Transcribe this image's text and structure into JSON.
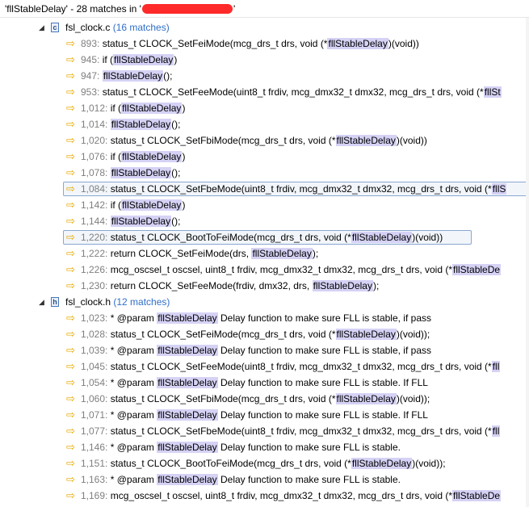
{
  "header": {
    "text_before": "'fllStableDelay' - 28 matches in '",
    "text_after": "'"
  },
  "files": [
    {
      "name": "fsl_clock.c",
      "count": "(16 matches)",
      "matches": [
        {
          "line": "893:",
          "before": "status_t CLOCK_SetFeiMode(mcg_drs_t drs, void (*",
          "hl": "fllStableDelay",
          "after": ")(void))"
        },
        {
          "line": "945:",
          "before": "if (",
          "hl": "fllStableDelay",
          "after": ")"
        },
        {
          "line": "947:",
          "before": "",
          "hl": "fllStableDelay",
          "after": "();"
        },
        {
          "line": "953:",
          "before": "status_t CLOCK_SetFeeMode(uint8_t frdiv, mcg_dmx32_t dmx32, mcg_drs_t drs, void (*",
          "hl": "fllSt",
          "after": ""
        },
        {
          "line": "1,012:",
          "before": "if (",
          "hl": "fllStableDelay",
          "after": ")"
        },
        {
          "line": "1,014:",
          "before": "",
          "hl": "fllStableDelay",
          "after": "();"
        },
        {
          "line": "1,020:",
          "before": "status_t CLOCK_SetFbiMode(mcg_drs_t drs, void (*",
          "hl": "fllStableDelay",
          "after": ")(void))"
        },
        {
          "line": "1,076:",
          "before": "if (",
          "hl": "fllStableDelay",
          "after": ")"
        },
        {
          "line": "1,078:",
          "before": "",
          "hl": "fllStableDelay",
          "after": "();"
        },
        {
          "line": "1,084:",
          "before": "status_t CLOCK_SetFbeMode(uint8_t frdiv, mcg_dmx32_t dmx32, mcg_drs_t drs, void (*",
          "hl": "fllS",
          "after": ""
        },
        {
          "line": "1,142:",
          "before": "if (",
          "hl": "fllStableDelay",
          "after": ")"
        },
        {
          "line": "1,144:",
          "before": "",
          "hl": "fllStableDelay",
          "after": "();"
        },
        {
          "line": "1,220:",
          "before": "status_t CLOCK_BootToFeiMode(mcg_drs_t drs, void (*",
          "hl": "fllStableDelay",
          "after": ")(void))"
        },
        {
          "line": "1,222:",
          "before": "return CLOCK_SetFeiMode(drs, ",
          "hl": "fllStableDelay",
          "after": ");"
        },
        {
          "line": "1,226:",
          "before": "mcg_oscsel_t oscsel, uint8_t frdiv, mcg_dmx32_t dmx32, mcg_drs_t drs, void (*",
          "hl": "fllStableDe",
          "after": ""
        },
        {
          "line": "1,230:",
          "before": "return CLOCK_SetFeeMode(frdiv, dmx32, drs, ",
          "hl": "fllStableDelay",
          "after": ");"
        }
      ]
    },
    {
      "name": "fsl_clock.h",
      "count": "(12 matches)",
      "matches": [
        {
          "line": "1,023:",
          "before": "* @param       ",
          "hl": "fllStableDelay",
          "after": " Delay function to make sure FLL is stable, if pass"
        },
        {
          "line": "1,028:",
          "before": "status_t CLOCK_SetFeiMode(mcg_drs_t drs, void (*",
          "hl": "fllStableDelay",
          "after": ")(void));"
        },
        {
          "line": "1,039:",
          "before": "* @param   ",
          "hl": "fllStableDelay",
          "after": " Delay function to make sure FLL is stable, if pass"
        },
        {
          "line": "1,045:",
          "before": "status_t CLOCK_SetFeeMode(uint8_t frdiv, mcg_dmx32_t dmx32, mcg_drs_t drs, void (*",
          "hl": "fll",
          "after": ""
        },
        {
          "line": "1,054:",
          "before": "* @param  ",
          "hl": "fllStableDelay",
          "after": " Delay function to make sure FLL is stable. If FLL"
        },
        {
          "line": "1,060:",
          "before": "status_t CLOCK_SetFbiMode(mcg_drs_t drs, void (*",
          "hl": "fllStableDelay",
          "after": ")(void));"
        },
        {
          "line": "1,071:",
          "before": "* @param  ",
          "hl": "fllStableDelay",
          "after": " Delay function to make sure FLL is stable. If FLL"
        },
        {
          "line": "1,077:",
          "before": "status_t CLOCK_SetFbeMode(uint8_t frdiv, mcg_dmx32_t dmx32, mcg_drs_t drs, void (*",
          "hl": "fll",
          "after": ""
        },
        {
          "line": "1,146:",
          "before": "* @param  ",
          "hl": "fllStableDelay",
          "after": " Delay function to make sure FLL is stable."
        },
        {
          "line": "1,151:",
          "before": "status_t CLOCK_BootToFeiMode(mcg_drs_t drs, void (*",
          "hl": "fllStableDelay",
          "after": ")(void));"
        },
        {
          "line": "1,163:",
          "before": "* @param  ",
          "hl": "fllStableDelay",
          "after": " Delay function to make sure FLL is stable."
        },
        {
          "line": "1,169:",
          "before": "mcg_oscsel_t oscsel, uint8_t frdiv, mcg_dmx32_t dmx32, mcg_drs_t drs, void (*",
          "hl": "fllStableDe",
          "after": ""
        }
      ]
    }
  ],
  "icons": {
    "expanded_twisty": "triangle-down-icon",
    "file": "c-source-file-icon",
    "match": "match-arrow-icon"
  },
  "colors": {
    "highlight": "#d5d2f5",
    "line_number": "#7f7f7f",
    "match_count": "#2f6fc8",
    "arrow": "#e6a800",
    "redaction": "#ff2a2a"
  }
}
